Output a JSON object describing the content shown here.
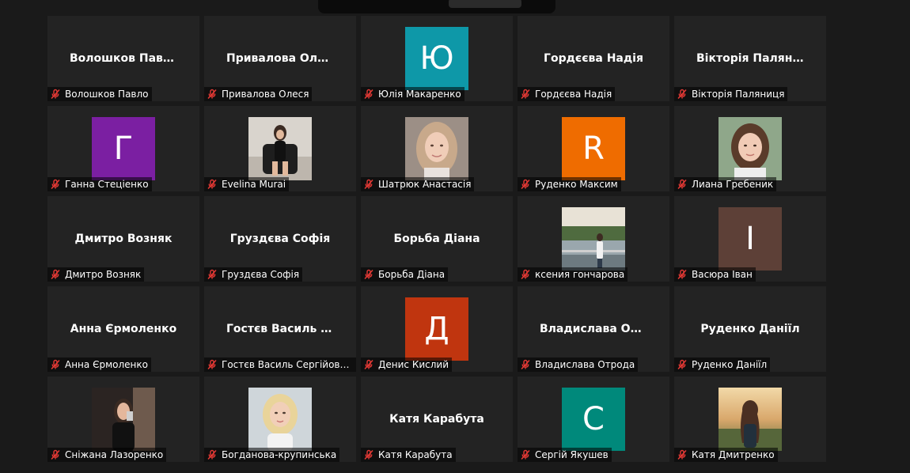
{
  "participants": [
    {
      "label": "Волошков Павло",
      "display": "Волошков Павло",
      "type": "name"
    },
    {
      "label": "Привалова Олеся",
      "display": "Привалова  Оле...",
      "type": "name"
    },
    {
      "label": "Юлія Макаренко",
      "letter": "Ю",
      "color": "#0e98a8",
      "type": "letter"
    },
    {
      "label": "Гордєєва Надія",
      "display": "Гордєєва Надія",
      "type": "name"
    },
    {
      "label": "Вікторія Паляниця",
      "display": "Вікторія  Палян...",
      "type": "name"
    },
    {
      "label": "Ганна Стеціенко",
      "letter": "Г",
      "color": "#7b1fa2",
      "type": "letter"
    },
    {
      "label": "Evelina Murai",
      "photo": "dark",
      "type": "photo"
    },
    {
      "label": "Шатрюк Анастасія",
      "photo": "blonde",
      "type": "photo"
    },
    {
      "label": "Руденко Максим",
      "letter": "R",
      "color": "#ef6c00",
      "type": "letter"
    },
    {
      "label": "Лиана Гребеник",
      "photo": "brunette",
      "type": "photo"
    },
    {
      "label": "Дмитро Возняк",
      "display": "Дмитро Возняк",
      "type": "name"
    },
    {
      "label": "Груздєва Софія",
      "display": "Груздєва Софія",
      "type": "name"
    },
    {
      "label": "Борьба Діана",
      "display": "Борьба Діана",
      "type": "name"
    },
    {
      "label": "ксения гончарова",
      "photo": "river",
      "type": "photo"
    },
    {
      "label": "Васюра Іван",
      "letter": "І",
      "color": "#5d4037",
      "type": "letter"
    },
    {
      "label": "Анна Єрмоленко",
      "display": "Анна Єрмоленко",
      "type": "name"
    },
    {
      "label": "Гостєв Василь Сергійович.",
      "display": "Гостєв  Василь  С...",
      "type": "name"
    },
    {
      "label": "Денис Кислий",
      "letter": "Д",
      "color": "#c0350f",
      "type": "letter"
    },
    {
      "label": "Владислава Отрода",
      "display": "Владислава  От...",
      "type": "name"
    },
    {
      "label": "Руденко Даніїл",
      "display": "Руденко Даніїл",
      "type": "name"
    },
    {
      "label": "Сніжана Лазоренко",
      "photo": "mirror",
      "type": "photo"
    },
    {
      "label": "Богданова-крупинська",
      "photo": "blondewoman",
      "type": "photo"
    },
    {
      "label": "Катя Карабута",
      "display": "Катя Карабута",
      "type": "name"
    },
    {
      "label": "Сергій Якушев",
      "letter": "С",
      "color": "#00897b",
      "type": "letter"
    },
    {
      "label": "Катя Дмитренко",
      "photo": "sunset",
      "type": "photo"
    }
  ],
  "icons": {
    "muted": "muted-mic-icon"
  },
  "colors": {
    "muted_icon": "#e53935",
    "tile_bg": "#232323",
    "page_bg": "#1a1a1a"
  }
}
